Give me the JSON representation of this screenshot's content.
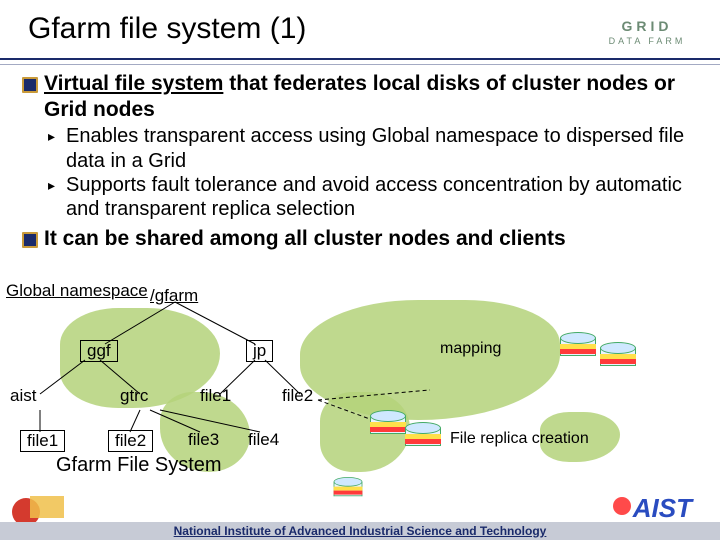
{
  "header": {
    "title": "Gfarm file system (1)",
    "logo_top": "GRID",
    "logo_bottom": "DATA FARM"
  },
  "bullets": {
    "main1_a": "Virtual file system",
    "main1_b": " that federates local disks of cluster nodes or Grid nodes",
    "sub1": "Enables transparent access using Global namespace to dispersed file data in a Grid",
    "sub2": "Supports fault tolerance and avoid access concentration by automatic and transparent replica selection",
    "main2": "It can be shared among all cluster nodes and clients"
  },
  "diagram": {
    "global_ns": "Global namespace",
    "root": "/gfarm",
    "n_ggf": "ggf",
    "n_jp": "jp",
    "n_aist": "aist",
    "n_gtrc": "gtrc",
    "n_file1": "file1",
    "n_file2": "file2",
    "n_file3": "file3",
    "n_file4": "file4",
    "note_mapping": "mapping",
    "note_replica": "File replica creation",
    "gfs_title": "Gfarm File System"
  },
  "footer": {
    "institute": "National Institute of Advanced Industrial Science and Technology",
    "aist": "AIST"
  }
}
